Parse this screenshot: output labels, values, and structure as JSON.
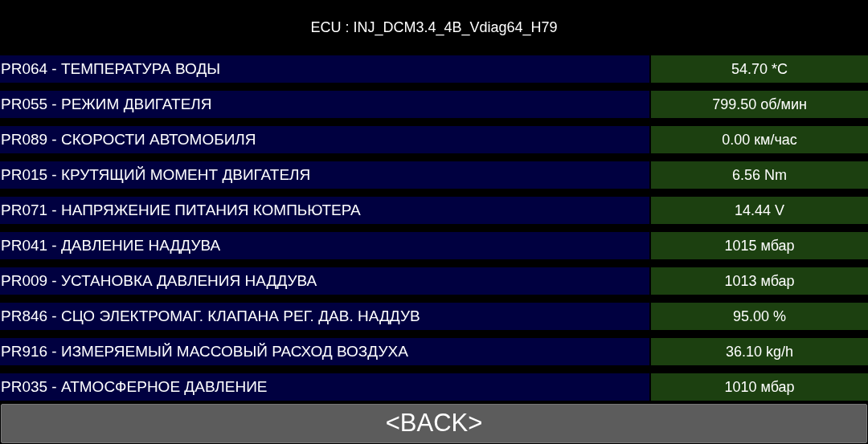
{
  "title": "ECU : INJ_DCM3.4_4B_Vdiag64_H79",
  "parameters": [
    {
      "name": "PR064 - ТЕМПЕРАТУРА ВОДЫ",
      "value": "54.70 *C"
    },
    {
      "name": "PR055 - РЕЖИМ ДВИГАТЕЛЯ",
      "value": "799.50 об/мин"
    },
    {
      "name": "PR089 - СКОРОСТИ АВТОМОБИЛЯ",
      "value": "0.00 км/час"
    },
    {
      "name": "PR015 - КРУТЯЩИЙ МОМЕНТ ДВИГАТЕЛЯ",
      "value": "6.56 Nm"
    },
    {
      "name": "PR071 - НАПРЯЖЕНИЕ ПИТАНИЯ КОМПЬЮТЕРА",
      "value": "14.44 V"
    },
    {
      "name": "PR041 - ДАВЛЕНИЕ НАДДУВА",
      "value": "1015 мбар"
    },
    {
      "name": "PR009 - УСТАНОВКА ДАВЛЕНИЯ НАДДУВА",
      "value": "1013 мбар"
    },
    {
      "name": "PR846 - СЦО ЭЛЕКТРОМАГ. КЛАПАНА РЕГ. ДАВ. НАДДУВ",
      "value": "95.00 %"
    },
    {
      "name": "PR916 - ИЗМЕРЯЕМЫЙ МАССОВЫЙ РАСХОД ВОЗДУХА",
      "value": "36.10 kg/h"
    },
    {
      "name": "PR035 - АТМОСФЕРНОЕ ДАВЛЕНИЕ",
      "value": "1010 мбар"
    }
  ],
  "back_button": "<BACK>"
}
